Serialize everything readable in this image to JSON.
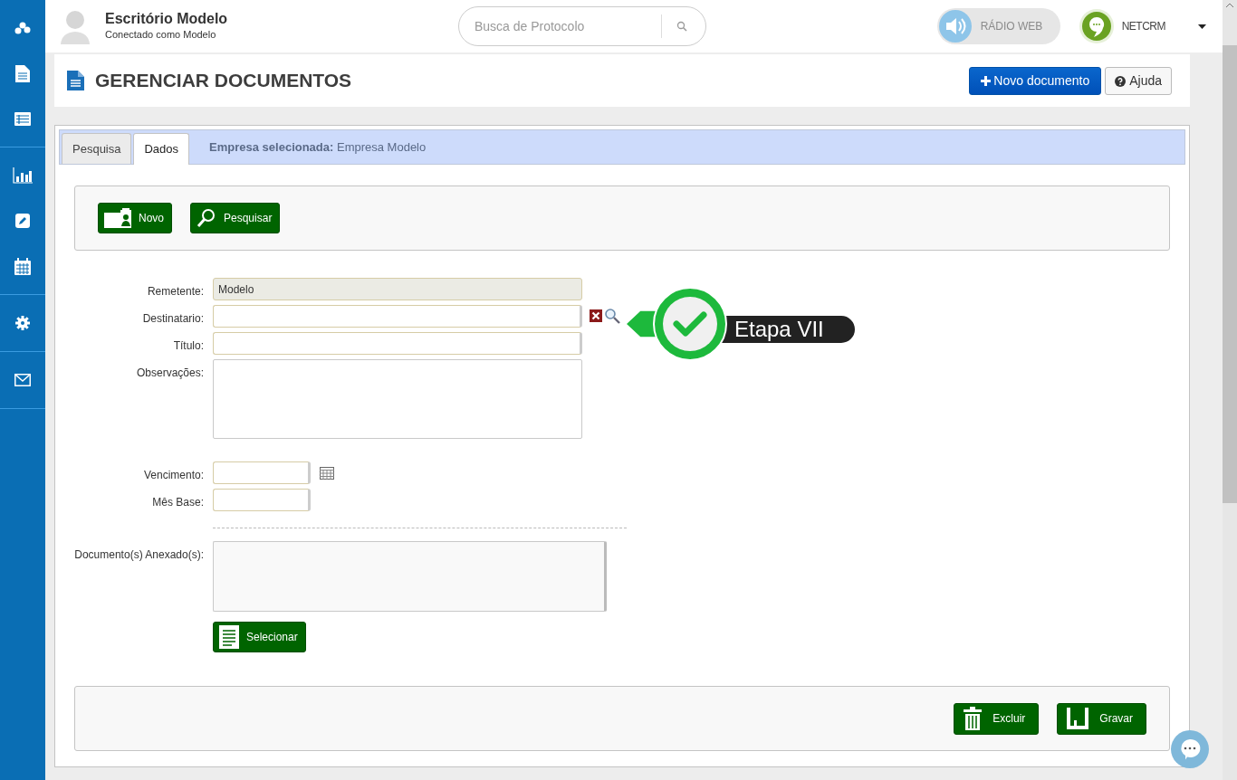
{
  "header": {
    "title": "Escritório Modelo",
    "subtitle": "Conectado como Modelo",
    "search_placeholder": "Busca de Protocolo",
    "radio_label": "RÁDIO WEB",
    "logo_text": "NETCRM"
  },
  "sidebar": {
    "groups": [
      {
        "items": [
          {
            "kind": "logo"
          },
          {
            "kind": "document"
          },
          {
            "kind": "list"
          }
        ]
      },
      {
        "items": [
          {
            "kind": "chart"
          },
          {
            "kind": "edit"
          },
          {
            "kind": "calendar"
          }
        ]
      },
      {
        "items": [
          {
            "kind": "gear"
          }
        ]
      },
      {
        "items": [
          {
            "kind": "mail"
          }
        ]
      }
    ]
  },
  "page": {
    "title": "GERENCIAR DOCUMENTOS",
    "buttons": [
      {
        "label": "Novo documento",
        "kind": "primary"
      },
      {
        "label": "Ajuda",
        "kind": "help"
      }
    ]
  },
  "tabs": [
    {
      "label": "Pesquisa",
      "selected": false
    },
    {
      "label": "Dados",
      "selected": true
    }
  ],
  "company": {
    "label": "Empresa selecionada:",
    "value": "Empresa Modelo"
  },
  "toolbar": [
    {
      "label": "Novo",
      "kind": "new"
    },
    {
      "label": "Pesquisar",
      "kind": "search"
    }
  ],
  "fields": [
    {
      "label": "Remetente:",
      "kind": "text",
      "value": "Modelo",
      "disabled": true
    },
    {
      "label": "Destinatario:",
      "kind": "lookup",
      "disabled": false
    },
    {
      "label": "Título:",
      "kind": "text",
      "disabled": false
    },
    {
      "label": "Observações:",
      "kind": "textarea",
      "disabled": false
    },
    {
      "label": "Vencimento:",
      "kind": "date",
      "disabled": false
    },
    {
      "label": "Mês Base:",
      "kind": "short",
      "disabled": false
    },
    {
      "label": "Documento(s) Anexado(s):",
      "kind": "list",
      "disabled": false
    }
  ],
  "attach_button": {
    "label": "Selecionar"
  },
  "callout": {
    "label": "Etapa VII"
  },
  "footer": [
    {
      "label": "Excluir",
      "kind": "delete"
    },
    {
      "label": "Gravar",
      "kind": "save"
    }
  ]
}
